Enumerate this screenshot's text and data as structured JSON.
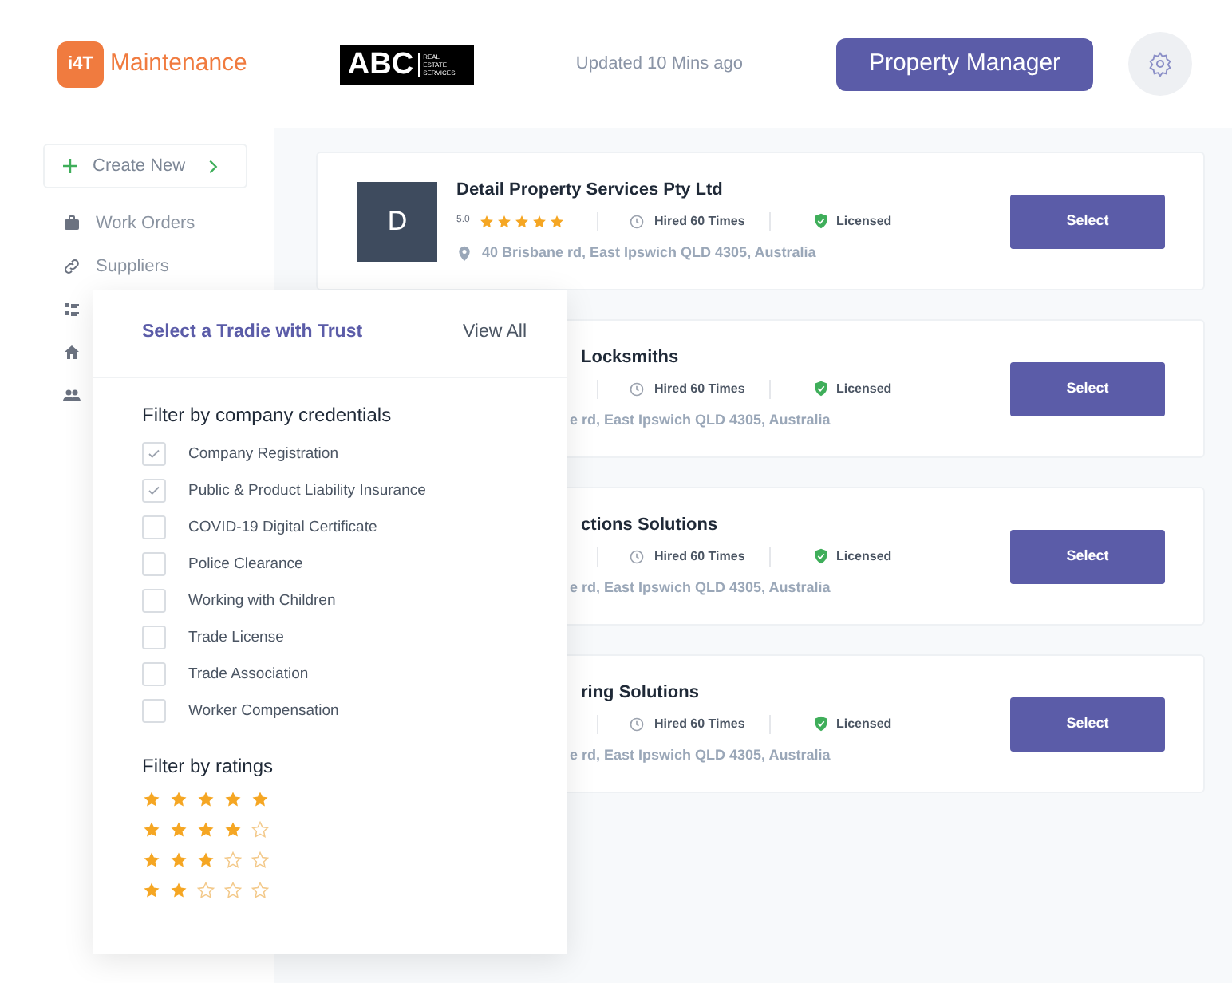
{
  "header": {
    "app_name": "Maintenance",
    "logo_text": "i4T",
    "agency_logo": {
      "main": "ABC",
      "sub": "REAL ESTATE SERVICES"
    },
    "updated": "Updated 10 Mins ago",
    "role_button": "Property Manager"
  },
  "sidebar": {
    "create_button": "Create New",
    "items": [
      {
        "label": "Work Orders"
      },
      {
        "label": "Suppliers"
      }
    ]
  },
  "tradies": [
    {
      "kind": "full",
      "avatar": "D",
      "name": "Detail Property Services Pty Ltd",
      "rating": "5.0",
      "stars": 5,
      "hired": "Hired 60 Times",
      "license": "Licensed",
      "address": "40 Brisbane rd, East Ipswich QLD 4305, Australia",
      "button": "Select"
    },
    {
      "kind": "partial",
      "name": "Locksmiths",
      "hired": "Hired 60 Times",
      "license": "Licensed",
      "address": "e rd, East Ipswich QLD 4305, Australia",
      "button": "Select"
    },
    {
      "kind": "partial",
      "name": "ctions Solutions",
      "hired": "Hired 60 Times",
      "license": "Licensed",
      "address": "e rd, East Ipswich QLD 4305, Australia",
      "button": "Select"
    },
    {
      "kind": "partial",
      "name": "ring Solutions",
      "hired": "Hired 60 Times",
      "license": "Licensed",
      "address": "e rd, East Ipswich QLD 4305, Australia",
      "button": "Select"
    }
  ],
  "filter_panel": {
    "title": "Select a Tradie with Trust",
    "view_all": "View All",
    "credentials_heading": "Filter by company credentials",
    "credentials": [
      {
        "label": "Company Registration",
        "checked": true
      },
      {
        "label": "Public & Product Liability Insurance",
        "checked": true
      },
      {
        "label": "COVID-19 Digital Certificate",
        "checked": false
      },
      {
        "label": "Police Clearance",
        "checked": false
      },
      {
        "label": "Working with Children",
        "checked": false
      },
      {
        "label": "Trade License",
        "checked": false
      },
      {
        "label": "Trade Association",
        "checked": false
      },
      {
        "label": "Worker Compensation",
        "checked": false
      }
    ],
    "ratings_heading": "Filter by ratings",
    "ratings": [
      {
        "stars": 5
      },
      {
        "stars": 4
      },
      {
        "stars": 3
      },
      {
        "stars": 2
      }
    ]
  }
}
